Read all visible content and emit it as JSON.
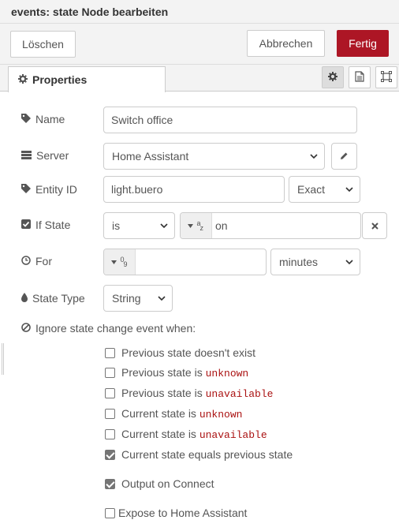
{
  "title": "events: state Node bearbeiten",
  "actions": {
    "delete_label": "Löschen",
    "cancel_label": "Abbrechen",
    "done_label": "Fertig"
  },
  "tabs": {
    "properties_label": "Properties"
  },
  "form": {
    "name": {
      "label": "Name",
      "value": "Switch office"
    },
    "server": {
      "label": "Server",
      "value": "Home Assistant"
    },
    "entity_id": {
      "label": "Entity ID",
      "value": "light.buero",
      "match": "Exact"
    },
    "if_state": {
      "label": "If State",
      "operator": "is",
      "type_symbol": "a",
      "type_sub": "z",
      "value": "on"
    },
    "for": {
      "label": "For",
      "type_symbol": "0",
      "type_sub": "9",
      "value": "",
      "unit": "minutes"
    },
    "state_type": {
      "label": "State Type",
      "value": "String"
    },
    "ignore": {
      "heading": "Ignore state change event when:",
      "items": [
        {
          "text": "Previous state doesn't exist",
          "code": "",
          "checked": false
        },
        {
          "text": "Previous state is ",
          "code": "unknown",
          "checked": false
        },
        {
          "text": "Previous state is ",
          "code": "unavailable",
          "checked": false
        },
        {
          "text": "Current state is ",
          "code": "unknown",
          "checked": false
        },
        {
          "text": "Current state is ",
          "code": "unavailable",
          "checked": false
        },
        {
          "text": "Current state equals previous state",
          "code": "",
          "checked": true
        }
      ]
    },
    "output_on_connect": {
      "text": "Output on Connect",
      "checked": true
    },
    "expose": {
      "text": "Expose to Home Assistant",
      "checked": false
    }
  },
  "colors": {
    "primary": "#ad1625",
    "code": "#aa1111"
  }
}
